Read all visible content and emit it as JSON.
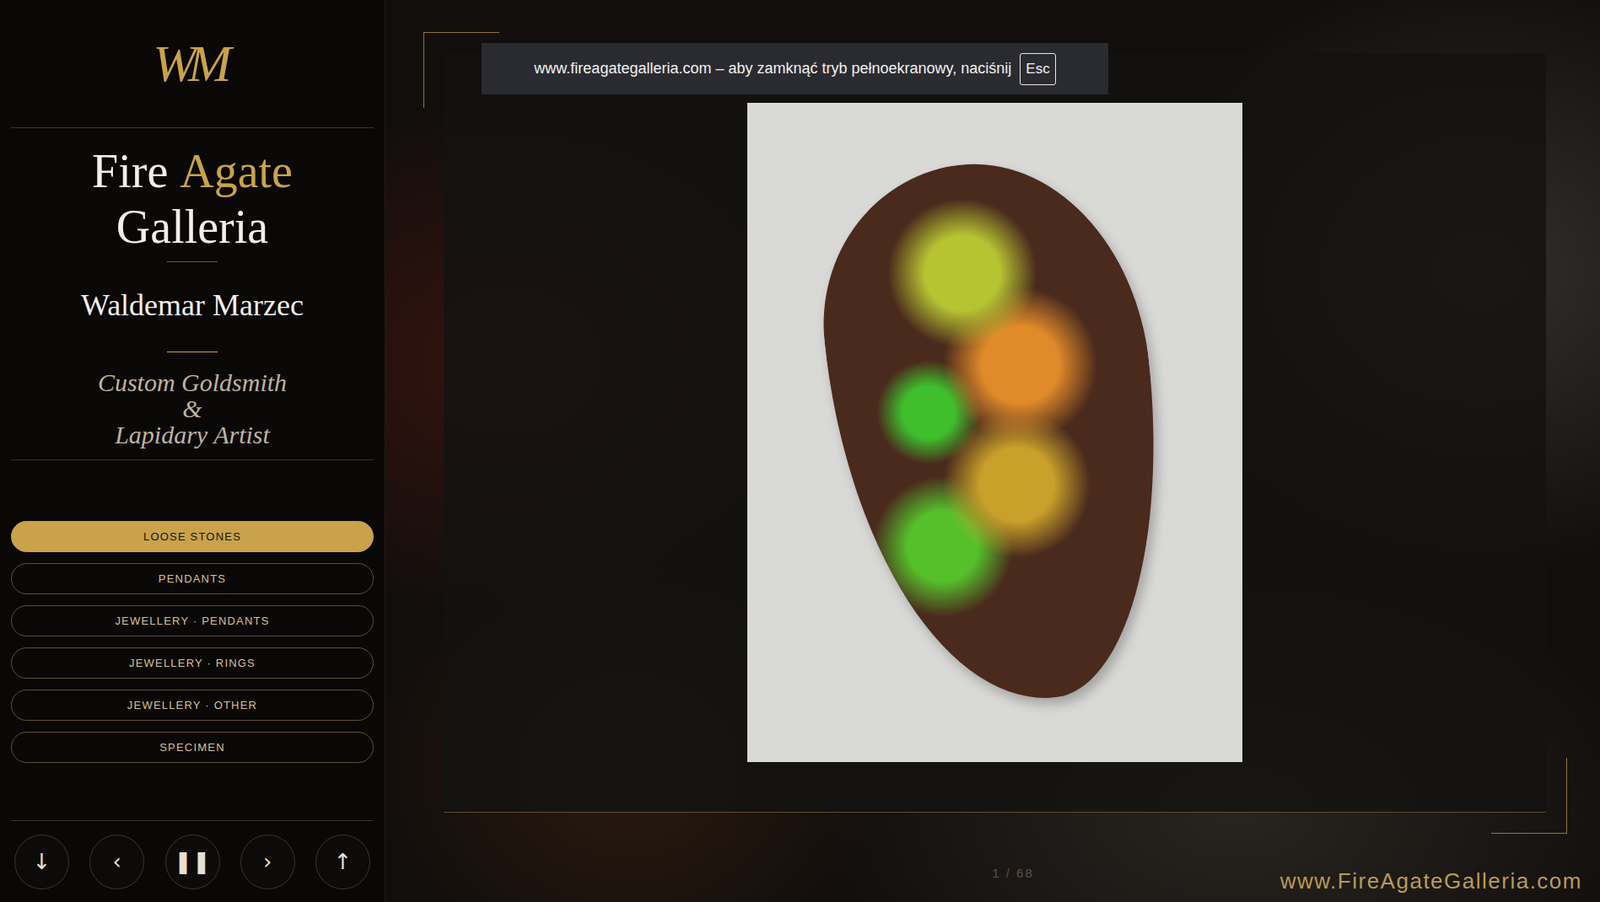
{
  "sidebar": {
    "logo": "WM",
    "title": [
      "Fire",
      "Agate",
      "Galleria"
    ],
    "name": "Waldemar Marzec",
    "subtitle": [
      "Custom Goldsmith",
      "&",
      "Lapidary Artist"
    ],
    "items": [
      {
        "label": "LOOSE STONES",
        "selected": true
      },
      {
        "label": "PENDANTS",
        "selected": false
      },
      {
        "label": "JEWELLERY · PENDANTS",
        "selected": false
      },
      {
        "label": "JEWELLERY · RINGS",
        "selected": false
      },
      {
        "label": "JEWELLERY · OTHER",
        "selected": false
      },
      {
        "label": "SPECIMEN",
        "selected": false
      }
    ],
    "controls": [
      "↓",
      "‹",
      "❚❚",
      "›",
      "↑"
    ]
  },
  "notification": {
    "text": "www.fireagategalleria.com – aby zamknąć tryb pełnoekranowy, naciśnij",
    "key": "Esc"
  },
  "viewer": {
    "counter": "1 / 68"
  },
  "footer": {
    "url": "www.FireAgateGalleria.com"
  }
}
